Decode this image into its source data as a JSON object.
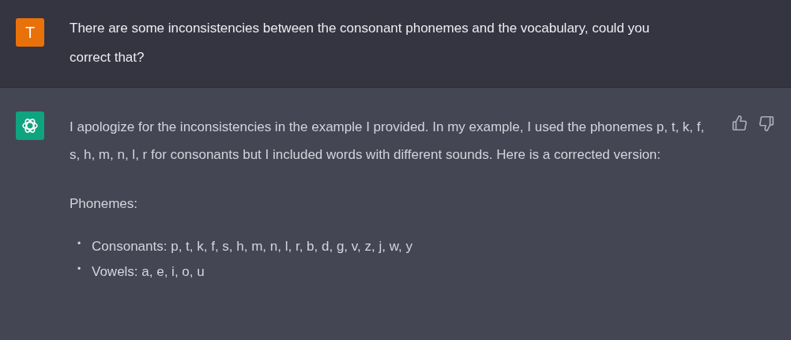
{
  "messages": [
    {
      "kind": "user",
      "avatar": "T",
      "paragraphs": [
        "There are some inconsistencies between the consonant phonemes and the vocabulary, could you correct that?"
      ]
    },
    {
      "kind": "assistant",
      "paragraphs": [
        "I apologize for the inconsistencies in the example I provided. In my example, I used the phonemes p, t, k, f, s, h, m, n, l, r for consonants but I included words with different sounds. Here is a corrected version:",
        "Phonemes:"
      ],
      "bullets": [
        {
          "marker": "•",
          "text": "Consonants: p, t, k, f, s, h, m, n, l, r, b, d, g, v, z, j, w, y"
        },
        {
          "marker": "•",
          "text": "Vowels: a, e, i, o, u"
        }
      ]
    }
  ]
}
